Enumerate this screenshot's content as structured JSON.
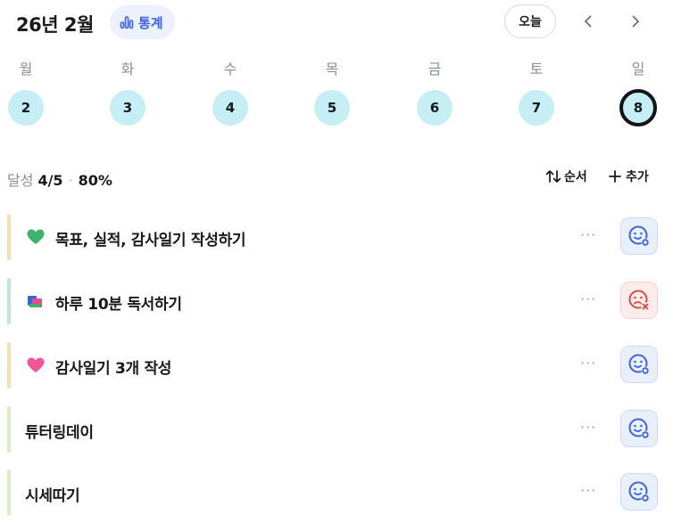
{
  "header": {
    "month_title": "26년 2월",
    "stats_label": "통계",
    "today_label": "오늘",
    "accent_color": "#3b62e6"
  },
  "week": {
    "weekdays": [
      "월",
      "화",
      "수",
      "목",
      "금",
      "토",
      "일"
    ],
    "dates": [
      "2",
      "3",
      "4",
      "5",
      "6",
      "7",
      "8"
    ],
    "selected_index": 6,
    "day_circle_color": "#c5eef5"
  },
  "summary": {
    "label": "달성",
    "count": "4/5",
    "percent": "80%",
    "sort_label": "순서",
    "add_label": "추가"
  },
  "tasks": [
    {
      "emoji": "green-heart-icon",
      "title": "목표, 실적, 감사일기 작성하기",
      "status": "success-face-icon",
      "bar_color": "#f7dfb4"
    },
    {
      "emoji": "books-icon",
      "title": "하루 10분 독서하기",
      "status": "fail-face-icon",
      "bar_color": "#bfe7d7"
    },
    {
      "emoji": "pink-heart-icon",
      "title": "감사일기 3개 작성",
      "status": "success-face-icon",
      "bar_color": "#f7dfb4"
    },
    {
      "emoji": "",
      "title": "튜터링데이",
      "status": "success-face-icon",
      "bar_color": "#dbeec0"
    },
    {
      "emoji": "",
      "title": "시세따기",
      "status": "success-face-icon",
      "bar_color": "#dbeec0"
    }
  ],
  "more_label": "···"
}
